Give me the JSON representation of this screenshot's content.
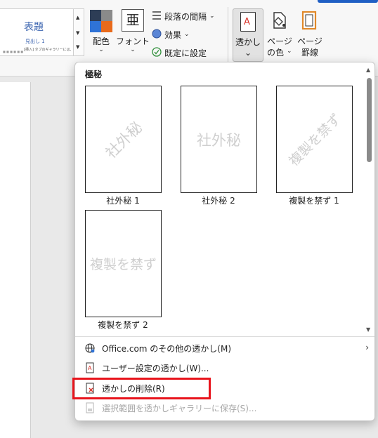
{
  "ribbon": {
    "style_gallery": {
      "title": "表題",
      "heading": "見出し 1",
      "body_preview": "[挿入] タブのギャラリーには、文書全",
      "footer_preview": "■ ■ ■ ■ ■ ■"
    },
    "design_colors": {
      "label": "配色",
      "chevron": "⌄"
    },
    "design_fonts": {
      "label": "フォント",
      "chevron": "⌄",
      "icon_glyph": "亜"
    },
    "paragraph_spacing": {
      "label": "段落の間隔",
      "chevron": "⌄"
    },
    "effects": {
      "label": "効果",
      "chevron": "⌄"
    },
    "set_as_default": {
      "label": "既定に設定"
    },
    "watermark": {
      "label": "透かし",
      "chevron": "⌄"
    },
    "page_color": {
      "label_line1": "ページ",
      "label_line2": "の色",
      "chevron": "⌄"
    },
    "page_borders": {
      "label_line1": "ページ",
      "label_line2": "罫線"
    }
  },
  "watermark_menu": {
    "section_title": "極秘",
    "gallery": [
      {
        "caption": "社外秘 1",
        "watermark_text": "社外秘",
        "orientation": "diagonal"
      },
      {
        "caption": "社外秘 2",
        "watermark_text": "社外秘",
        "orientation": "horizontal"
      },
      {
        "caption": "複製を禁ず 1",
        "watermark_text": "複製を禁ず",
        "orientation": "diagonal"
      },
      {
        "caption": "複製を禁ず 2",
        "watermark_text": "複製を禁ず",
        "orientation": "horizontal"
      }
    ],
    "items": [
      {
        "label": "Office.com のその他の透かし(M)",
        "icon": "globe-icon",
        "enabled": true,
        "has_submenu": true
      },
      {
        "label": "ユーザー設定の透かし(W)...",
        "icon": "custom-watermark-icon",
        "enabled": true
      },
      {
        "label": "透かしの削除(R)",
        "icon": "remove-watermark-icon",
        "enabled": true,
        "highlighted": true
      },
      {
        "label": "選択範囲を透かしギャラリーに保存(S)...",
        "icon": "save-watermark-icon",
        "enabled": false
      }
    ],
    "scroll": {
      "up": "▲",
      "down": "▼"
    },
    "submenu_arrow": "›"
  },
  "colors": {
    "highlight_box": "#e8141c",
    "ribbon_bg": "#f7f7f7",
    "accent_blue": "#1f5fc4",
    "watermark_gray": "#cfcfcf"
  }
}
